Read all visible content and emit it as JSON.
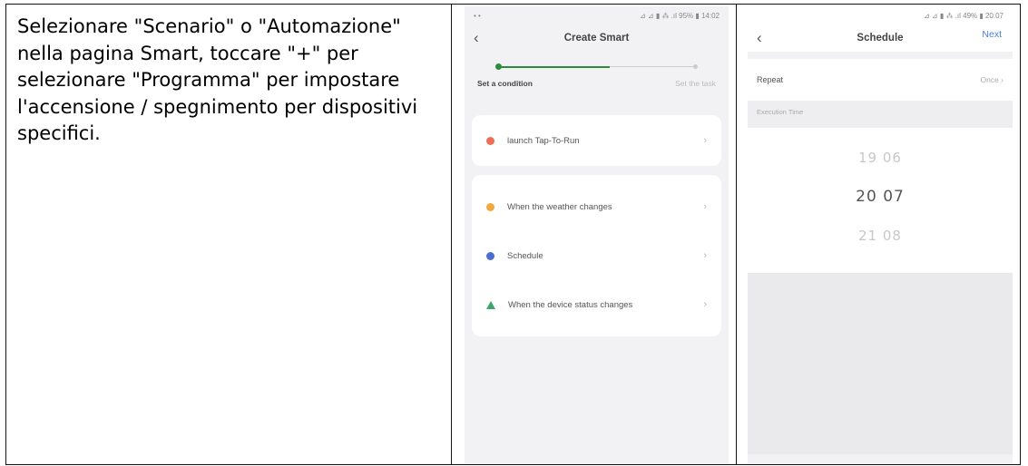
{
  "instruction": "Selezionare \"Scenario\" o \"Automazione\" nella pagina Smart, toccare \"+\" per selezionare \"Programma\" per impostare l'accensione / spegnimento per dispositivi specifici.",
  "screen_a": {
    "status_left": "• •",
    "status_right": "⊿ ⊿ ▮ ⁂ .ıl 95% ▮ 14:02",
    "title": "Create Smart",
    "back": "‹",
    "step_1": "Set a condition",
    "step_2": "Set the task",
    "tap_card": {
      "label": "launch Tap-To-Run",
      "chevron": "›"
    },
    "items": [
      {
        "label": "When the weather changes",
        "chevron": "›"
      },
      {
        "label": "Schedule",
        "chevron": "›"
      },
      {
        "label": "When the device status changes",
        "chevron": "›"
      }
    ]
  },
  "screen_b": {
    "status_right": "⊿ ⊿ ▮ ⁂ .ıl 49% ▮ 20:07",
    "title": "Schedule",
    "back": "‹",
    "next": "Next",
    "repeat_label": "Repeat",
    "repeat_value": "Once ›",
    "section": "Execution Time",
    "time_prev": "19  06",
    "time_current": "20  07",
    "time_next": "21  08"
  }
}
